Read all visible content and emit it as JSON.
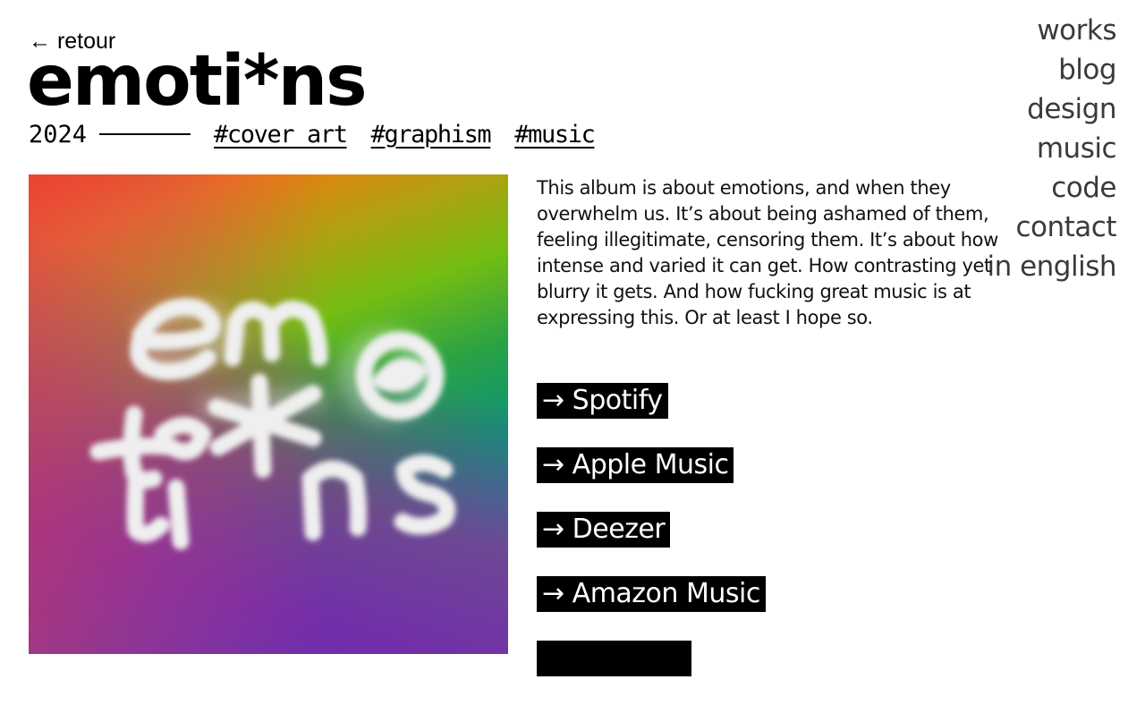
{
  "header": {
    "back_label": "← retour",
    "title": "emoti*ns",
    "year": "2024",
    "tags": [
      "#cover art",
      "#graphism",
      "#music"
    ]
  },
  "nav": {
    "items": [
      "works",
      "blog",
      "design",
      "music",
      "code",
      "contact",
      "in english"
    ]
  },
  "cover": {
    "alt_text": "emotions album cover"
  },
  "description": "This album is about emotions, and when they overwhelm us. It’s about being ashamed of them, feeling illegitimate, censoring them. It’s about how intense and varied it can get. How contrasting yet blurry it gets. And how fucking great music is at expressing this. Or at least I hope so.",
  "links": {
    "items": [
      "→ Spotify",
      "→ Apple Music",
      "→ Deezer",
      "→ Amazon Music",
      ""
    ]
  },
  "colors": {
    "text": "#000000",
    "nav_text": "#3a3a3a",
    "link_bg": "#000000",
    "link_text": "#ffffff"
  }
}
